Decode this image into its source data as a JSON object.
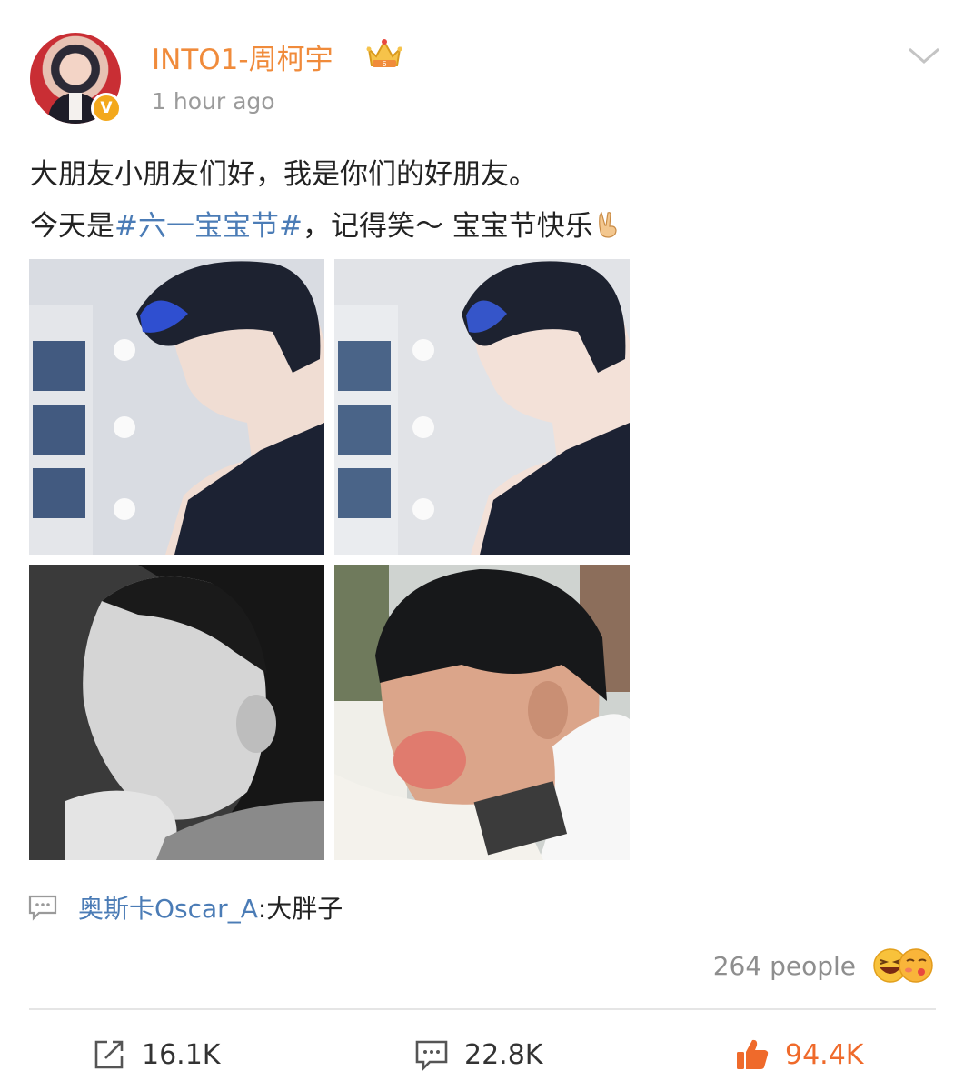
{
  "post": {
    "username": "INTO1-周柯宇",
    "timestamp": "1 hour ago",
    "verified_badge": "V",
    "text_line1": "大朋友小朋友们好，我是你们的好朋友。",
    "text_line2_prefix": "今天是",
    "hashtag": "#六一宝宝节#",
    "text_line2_suffix": "，记得笑～ 宝宝节快乐",
    "photos": [
      {
        "icon": "portrait-photo-icon"
      },
      {
        "icon": "portrait-photo-icon"
      },
      {
        "icon": "child-photo-icon"
      },
      {
        "icon": "child-photo-icon"
      }
    ]
  },
  "comment_preview": {
    "user": "奥斯卡Oscar_A",
    "text": ":大胖子"
  },
  "reactions": {
    "count_text": "264 people"
  },
  "actions": {
    "repost_count": "16.1K",
    "comment_count": "22.8K",
    "like_count": "94.4K"
  },
  "colors": {
    "username": "#f08b3b",
    "hashtag": "#4b7cb6",
    "like": "#ef6a2b",
    "badge": "#f3a81c"
  }
}
